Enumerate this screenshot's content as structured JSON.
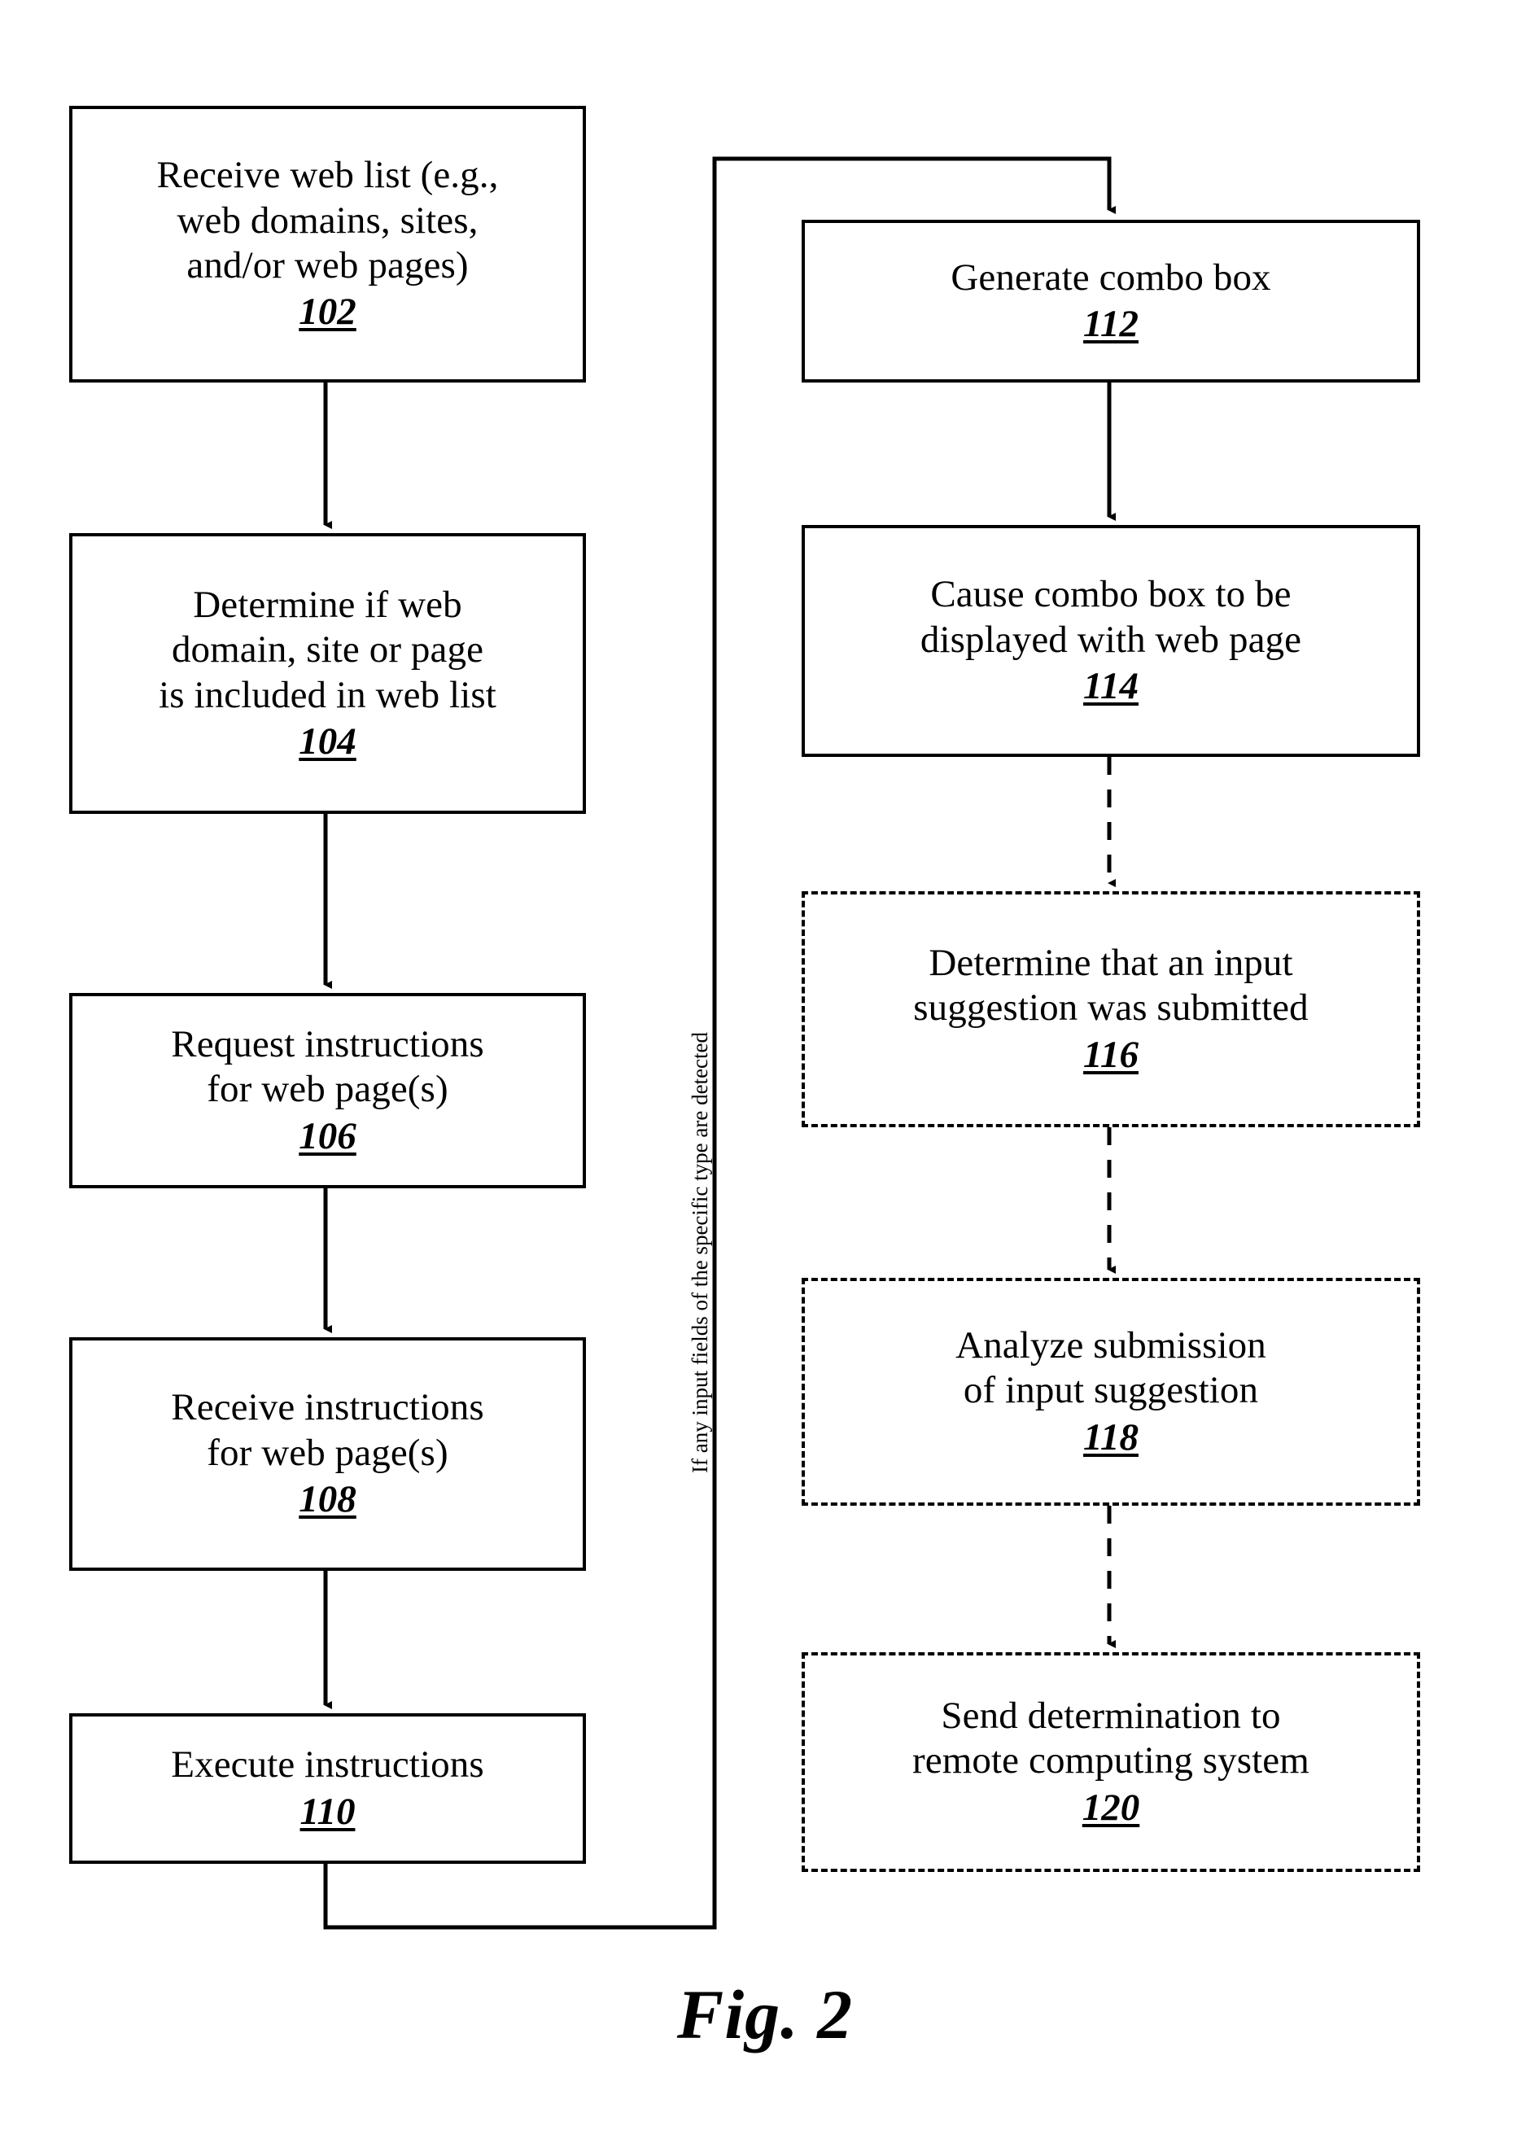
{
  "figure": {
    "caption": "Fig. 2",
    "loop_label": "If any input fields of the specific type are detected",
    "line_color": "#000000",
    "background_color": "#ffffff"
  },
  "left_column": {
    "steps": [
      {
        "ref": "102",
        "text": "Receive web list (e.g.,\nweb domains, sites,\nand/or web pages)",
        "border": "solid"
      },
      {
        "ref": "104",
        "text": "Determine if web\ndomain, site or page\nis included in web list",
        "border": "solid"
      },
      {
        "ref": "106",
        "text": "Request instructions\nfor web page(s)",
        "border": "solid"
      },
      {
        "ref": "108",
        "text": "Receive instructions\nfor web page(s)",
        "border": "solid"
      },
      {
        "ref": "110",
        "text": "Execute instructions",
        "border": "solid"
      }
    ]
  },
  "right_column": {
    "steps": [
      {
        "ref": "112",
        "text": "Generate combo box",
        "border": "solid"
      },
      {
        "ref": "114",
        "text": "Cause combo box to be\ndisplayed with web page",
        "border": "solid"
      },
      {
        "ref": "116",
        "text": "Determine that an input\nsuggestion was submitted",
        "border": "dashed"
      },
      {
        "ref": "118",
        "text": "Analyze submission\nof input suggestion",
        "border": "dashed"
      },
      {
        "ref": "120",
        "text": "Send determination to\nremote computing system",
        "border": "dashed"
      }
    ]
  },
  "chart_data": {
    "type": "diagram",
    "title": "Fig. 2",
    "nodes": [
      {
        "id": "102",
        "label": "Receive web list (e.g., web domains, sites, and/or web pages)",
        "style": "solid",
        "column": "left"
      },
      {
        "id": "104",
        "label": "Determine if web domain, site or page is included in web list",
        "style": "solid",
        "column": "left"
      },
      {
        "id": "106",
        "label": "Request instructions for web page(s)",
        "style": "solid",
        "column": "left"
      },
      {
        "id": "108",
        "label": "Receive instructions for web page(s)",
        "style": "solid",
        "column": "left"
      },
      {
        "id": "110",
        "label": "Execute instructions",
        "style": "solid",
        "column": "left"
      },
      {
        "id": "112",
        "label": "Generate combo box",
        "style": "solid",
        "column": "right"
      },
      {
        "id": "114",
        "label": "Cause combo box to be displayed with web page",
        "style": "solid",
        "column": "right"
      },
      {
        "id": "116",
        "label": "Determine that an input suggestion was submitted",
        "style": "dashed",
        "column": "right"
      },
      {
        "id": "118",
        "label": "Analyze submission of input suggestion",
        "style": "dashed",
        "column": "right"
      },
      {
        "id": "120",
        "label": "Send determination to remote computing system",
        "style": "dashed",
        "column": "right"
      }
    ],
    "edges": [
      {
        "from": "102",
        "to": "104",
        "style": "solid"
      },
      {
        "from": "104",
        "to": "106",
        "style": "solid"
      },
      {
        "from": "106",
        "to": "108",
        "style": "solid"
      },
      {
        "from": "108",
        "to": "110",
        "style": "solid"
      },
      {
        "from": "110",
        "to": "112",
        "style": "solid",
        "label": "If any input fields of the specific type are detected"
      },
      {
        "from": "112",
        "to": "114",
        "style": "solid"
      },
      {
        "from": "114",
        "to": "116",
        "style": "dashed"
      },
      {
        "from": "116",
        "to": "118",
        "style": "dashed"
      },
      {
        "from": "118",
        "to": "120",
        "style": "dashed"
      }
    ]
  }
}
